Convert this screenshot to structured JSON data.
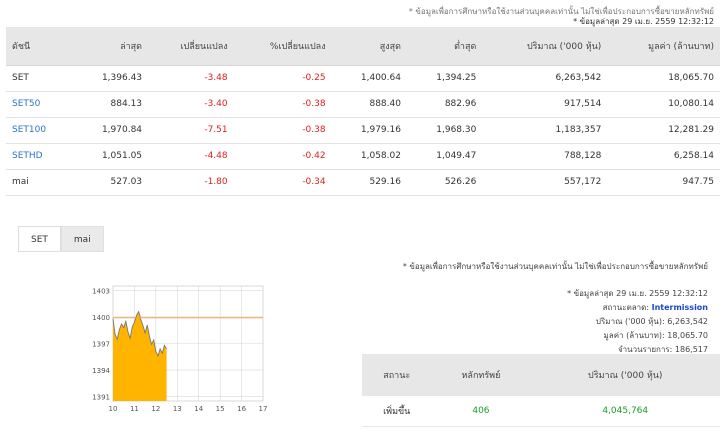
{
  "notes": {
    "disclaimer": "* ข้อมูลเพื่อการศึกษาหรือใช้งานส่วนบุคคลเท่านั้น ไม่ใช่เพื่อประกอบการซื้อขายหลักทรัพย์",
    "updated": "* ข้อมูลล่าสุด 29 เม.ย. 2559 12:32:12"
  },
  "index_table": {
    "headers": [
      "ดัชนี",
      "ล่าสุด",
      "เปลี่ยนแปลง",
      "%เปลี่ยนแปลง",
      "สูงสุด",
      "ต่ำสุด",
      "ปริมาณ ('000 หุ้น)",
      "มูลค่า (ล้านบาท)"
    ],
    "rows": [
      {
        "name": "SET",
        "last": "1,396.43",
        "change": "-3.48",
        "pct": "-0.25",
        "high": "1,400.64",
        "low": "1,394.25",
        "volume": "6,263,542",
        "value": "18,065.70",
        "link": false
      },
      {
        "name": "SET50",
        "last": "884.13",
        "change": "-3.40",
        "pct": "-0.38",
        "high": "888.40",
        "low": "882.96",
        "volume": "917,514",
        "value": "10,080.14",
        "link": true
      },
      {
        "name": "SET100",
        "last": "1,970.84",
        "change": "-7.51",
        "pct": "-0.38",
        "high": "1,979.16",
        "low": "1,968.30",
        "volume": "1,183,357",
        "value": "12,281.29",
        "link": true
      },
      {
        "name": "SETHD",
        "last": "1,051.05",
        "change": "-4.48",
        "pct": "-0.42",
        "high": "1,058.02",
        "low": "1,049.47",
        "volume": "788,128",
        "value": "6,258.14",
        "link": true
      },
      {
        "name": "mai",
        "last": "527.03",
        "change": "-1.80",
        "pct": "-0.34",
        "high": "529.16",
        "low": "526.26",
        "volume": "557,172",
        "value": "947.75",
        "link": false
      }
    ]
  },
  "tabs": [
    "SET",
    "mai"
  ],
  "market_info": {
    "disclaimer": "* ข้อมูลเพื่อการศึกษาหรือใช้งานส่วนบุคคลเท่านั้น ไม่ใช่เพื่อประกอบการซื้อขายหลักทรัพย์",
    "updated": "* ข้อมูลล่าสุด 29 เม.ย. 2559 12:32:12",
    "status_label": "สถานะตลาด:",
    "status_value": "Intermission",
    "volume_label": "ปริมาณ ('000 หุ้น)",
    "volume_value": "6,263,542",
    "value_label": "มูลค่า (ล้านบาท)",
    "value_value": "18,065.70",
    "trades_label": "จำนวนรายการ",
    "trades_value": "186,517"
  },
  "stat_table": {
    "headers": [
      "สถานะ",
      "หลักทรัพย์",
      "ปริมาณ ('000 หุ้น)"
    ],
    "rows": [
      {
        "status": "เพิ่มขึ้น",
        "count": "406",
        "volume": "4,045,764"
      }
    ]
  },
  "chart_data": {
    "type": "area",
    "x_ticks": [
      "10",
      "11",
      "12",
      "13",
      "14",
      "15",
      "16",
      "17"
    ],
    "y_ticks": [
      "1403",
      "1400",
      "1397",
      "1394",
      "1391"
    ],
    "xlim": [
      10,
      17
    ],
    "ylim": [
      1390.5,
      1403.5
    ],
    "reference": 1399.91,
    "x": [
      10.0,
      10.1,
      10.2,
      10.3,
      10.4,
      10.5,
      10.6,
      10.7,
      10.8,
      10.9,
      11.0,
      11.1,
      11.2,
      11.3,
      11.4,
      11.5,
      11.6,
      11.7,
      11.8,
      11.9,
      12.0,
      12.1,
      12.2,
      12.3,
      12.4,
      12.5
    ],
    "y": [
      1399.8,
      1398.0,
      1397.5,
      1398.6,
      1399.2,
      1398.8,
      1399.5,
      1398.3,
      1397.6,
      1398.9,
      1399.4,
      1400.2,
      1400.6,
      1399.7,
      1399.0,
      1398.2,
      1399.1,
      1397.8,
      1396.9,
      1397.4,
      1396.1,
      1395.6,
      1396.4,
      1395.9,
      1396.8,
      1396.4
    ],
    "colors": {
      "fill": "#ffb400",
      "line": "#777777",
      "ref": "#f2a14a",
      "grid": "#d8d8d8"
    }
  }
}
